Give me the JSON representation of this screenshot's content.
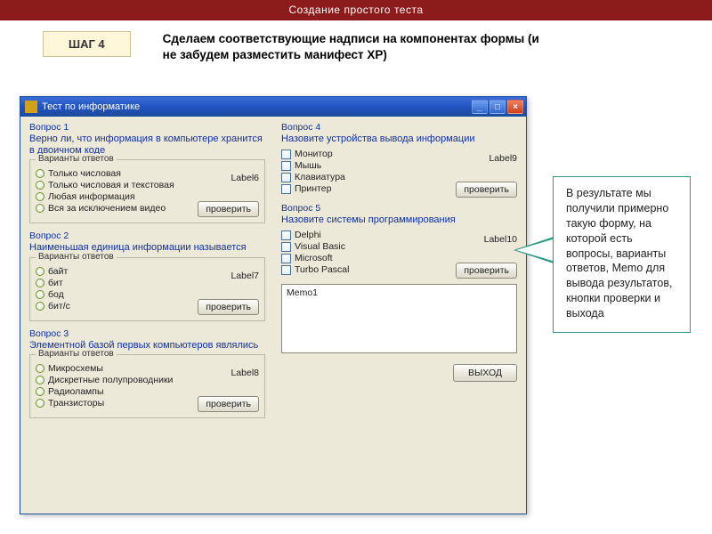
{
  "banner": "Создание простого теста",
  "step_label": "ШАГ 4",
  "instruction": "Сделаем соответствующие надписи на компонентах формы (и не забудем разместить манифест XP)",
  "window": {
    "title": "Тест по информатике",
    "groupbox_legend": "Варианты ответов",
    "check_button": "проверить",
    "exit_button": "ВЫХОД",
    "memo_text": "Memo1",
    "questions": [
      {
        "num": "Вопрос 1",
        "text": "Верно ли, что информация в компьютере хранится в двоичном коде",
        "type": "radio",
        "label_stub": "Label6",
        "options": [
          "Только числовая",
          "Только числовая и текстовая",
          "Любая информация",
          "Вся за исключением видео"
        ]
      },
      {
        "num": "Вопрос 2",
        "text": "Наименьшая единица информации называется",
        "type": "radio",
        "label_stub": "Label7",
        "options": [
          "байт",
          "бит",
          "бод",
          "бит/с"
        ]
      },
      {
        "num": "Вопрос 3",
        "text": "Элементной базой первых компьютеров являлись",
        "type": "radio",
        "label_stub": "Label8",
        "options": [
          "Микросхемы",
          "Дискретные полупроводники",
          "Радиолампы",
          "Транзисторы"
        ]
      },
      {
        "num": "Вопрос 4",
        "text": "Назовите устройства вывода информации",
        "type": "check",
        "label_stub": "Label9",
        "options": [
          "Монитор",
          "Мышь",
          "Клавиатура",
          "Принтер"
        ]
      },
      {
        "num": "Вопрос 5",
        "text": "Назовите системы программирования",
        "type": "check",
        "label_stub": "Label10",
        "options": [
          "Delphi",
          "Visual Basic",
          "Microsoft",
          "Turbo Pascal"
        ]
      }
    ]
  },
  "callout": "   В результате мы получили примерно такую форму, на которой есть вопросы, варианты ответов, Memo для вывода результатов,  кнопки проверки и выхода"
}
